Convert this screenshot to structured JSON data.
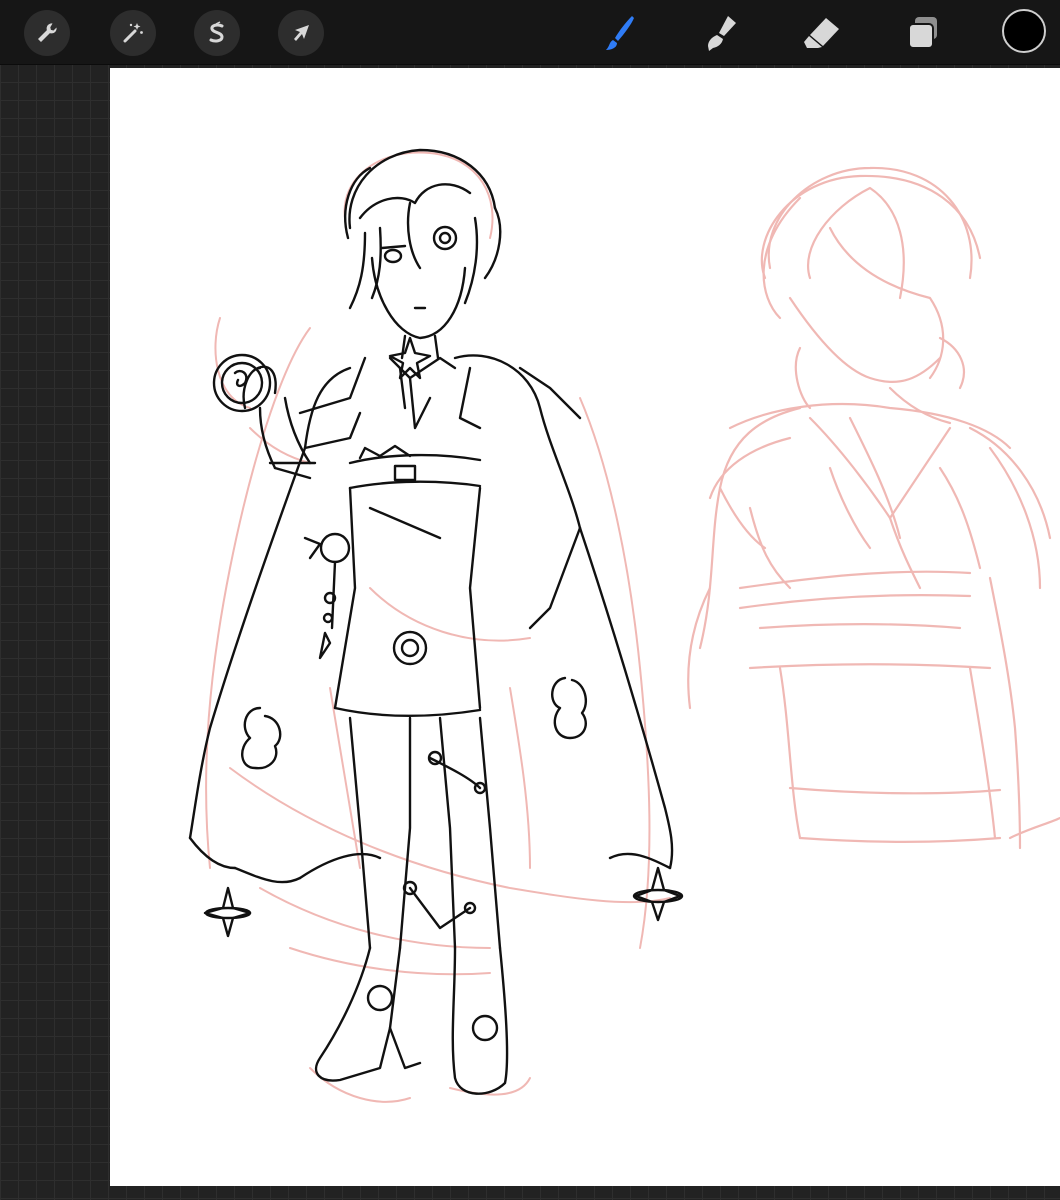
{
  "app": {
    "accent_color": "#2f7cf6",
    "icon_color": "#d8d8d8",
    "current_color": "#000000"
  },
  "toolbar": {
    "left_tools": [
      {
        "name": "actions",
        "icon": "wrench-icon"
      },
      {
        "name": "adjustments",
        "icon": "magic-wand-icon"
      },
      {
        "name": "selection",
        "icon": "selection-s-icon"
      },
      {
        "name": "transform",
        "icon": "arrow-cursor-icon"
      }
    ],
    "right_tools": [
      {
        "name": "brush",
        "icon": "brush-icon",
        "active": true
      },
      {
        "name": "smudge",
        "icon": "smudge-icon",
        "active": false
      },
      {
        "name": "eraser",
        "icon": "eraser-icon",
        "active": false
      },
      {
        "name": "layers",
        "icon": "layers-icon",
        "active": false
      }
    ]
  },
  "artwork": {
    "lineart_color": "#111111",
    "sketch_color": "#f0b8b4"
  }
}
